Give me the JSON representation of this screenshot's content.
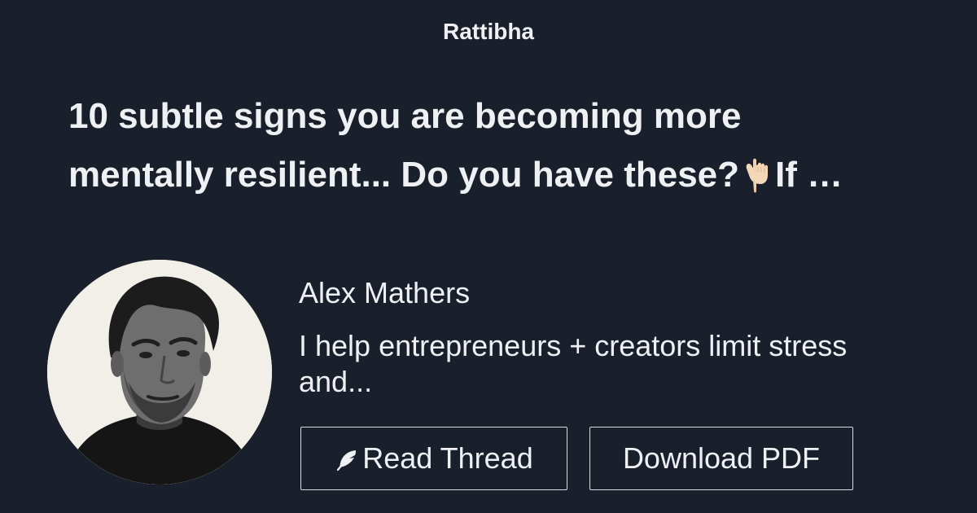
{
  "brand": "Rattibha",
  "thread": {
    "title_line1": "10 subtle signs you are becoming more",
    "title_line2_prefix": "mentally resilient... Do you have these?",
    "title_line2_suffix": "If …",
    "emoji_icon": "backhand-index-pointing-down-icon"
  },
  "author": {
    "name": "Alex Mathers",
    "bio_line1": "I help entrepreneurs + creators limit stress",
    "bio_line2": "and..."
  },
  "buttons": {
    "read_label": "Read Thread",
    "read_icon": "feather-icon",
    "pdf_label": "Download PDF"
  },
  "colors": {
    "background": "#19202b",
    "text": "#eef0f3",
    "button_border": "#d8dbe0"
  }
}
